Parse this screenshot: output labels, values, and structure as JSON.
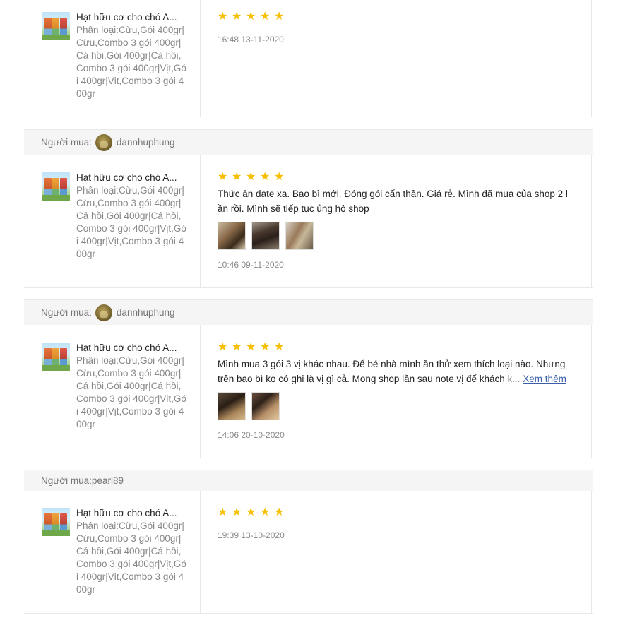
{
  "reviews": [
    {
      "buyer_label": "",
      "buyer_name": "",
      "product_name": "Hạt hữu cơ cho chó A...",
      "variation": "Phân loại:Cừu,Gói 400gr|Cừu,Combo 3 gói 400gr|Cá hồi,Gói 400gr|Cá hồi,Combo 3 gói 400gr|Vịt,Gói 400gr|Vịt,Combo 3 gói 400gr",
      "rating": 5,
      "comment": "",
      "timestamp": "16:48 13-11-2020"
    },
    {
      "buyer_label": "Người mua:",
      "buyer_name": "dannhuphung",
      "product_name": "Hạt hữu cơ cho chó A...",
      "variation": "Phân loại:Cừu,Gói 400gr|Cừu,Combo 3 gói 400gr|Cá hồi,Gói 400gr|Cá hồi,Combo 3 gói 400gr|Vịt,Gói 400gr|Vịt,Combo 3 gói 400gr",
      "rating": 5,
      "comment_line1": "Thức ăn date xa. Bao bì mới. Đóng gói cẩn thận. Giá rẻ. Mình đã mua của shop 2 l",
      "comment_line2": "ần rồi. Mình sẽ tiếp tục ủng hộ shop",
      "photo_count": 3,
      "timestamp": "10:46 09-11-2020"
    },
    {
      "buyer_label": "Người mua:",
      "buyer_name": "dannhuphung",
      "product_name": "Hạt hữu cơ cho chó A...",
      "variation": "Phân loại:Cừu,Gói 400gr|Cừu,Combo 3 gói 400gr|Cá hồi,Gói 400gr|Cá hồi,Combo 3 gói 400gr|Vịt,Gói 400gr|Vịt,Combo 3 gói 400gr",
      "rating": 5,
      "comment_line1": "Mình mua 3 gói 3 vị khác nhau. Để bé nhà mình ăn thử xem thích loại nào. Nhưng",
      "comment_line2": "trên bao bì ko có ghi là vị gì cả. Mong shop lần sau note vị để khách",
      "comment_fade": " k...",
      "see_more": "Xem thêm",
      "photo_count": 2,
      "timestamp": "14:06 20-10-2020"
    },
    {
      "buyer_label": "Người mua:",
      "buyer_name": "pearl89",
      "product_name": "Hạt hữu cơ cho chó A...",
      "variation": "Phân loại:Cừu,Gói 400gr|Cừu,Combo 3 gói 400gr|Cá hồi,Gói 400gr|Cá hồi,Combo 3 gói 400gr|Vịt,Gói 400gr|Vịt,Combo 3 gói 400gr",
      "rating": 5,
      "comment": "",
      "timestamp": "19:39 13-10-2020"
    }
  ],
  "colors": {
    "star": "#f6c000",
    "link": "#3a5fa8",
    "bar_bg": "#f5f5f5",
    "muted_text": "#888888"
  },
  "icons": {
    "star": "star-icon",
    "avatar": "avatar"
  }
}
